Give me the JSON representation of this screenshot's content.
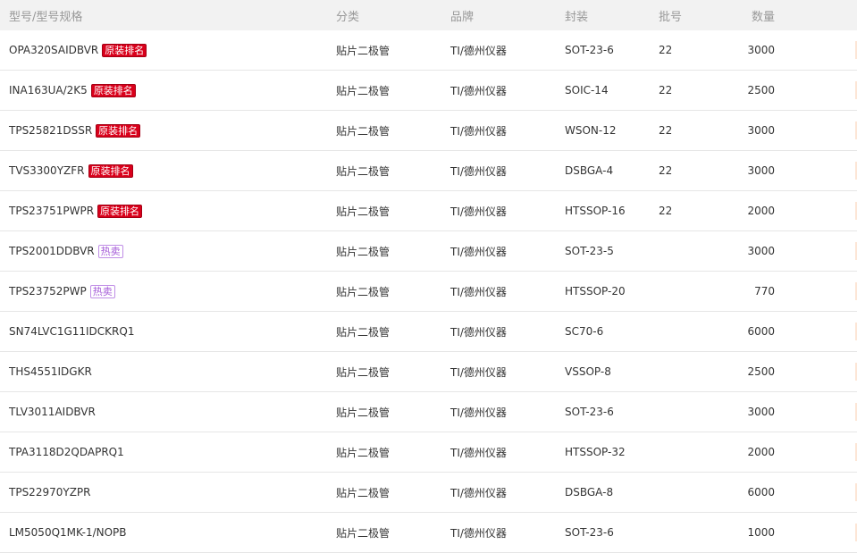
{
  "header": {
    "model": "型号/型号规格",
    "category": "分类",
    "brand": "品牌",
    "package": "封装",
    "batch": "批号",
    "quantity": "数量"
  },
  "rows": [
    {
      "model": "OPA320SAIDBVR",
      "badge": "原装排名",
      "badge_type": "red",
      "category": "贴片二极管",
      "brand": "TI/德州仪器",
      "package": "SOT-23-6",
      "batch": "22",
      "quantity": "3000"
    },
    {
      "model": "INA163UA/2K5",
      "badge": "原装排名",
      "badge_type": "red",
      "category": "贴片二极管",
      "brand": "TI/德州仪器",
      "package": "SOIC-14",
      "batch": "22",
      "quantity": "2500"
    },
    {
      "model": "TPS25821DSSR",
      "badge": "原装排名",
      "badge_type": "red",
      "category": "贴片二极管",
      "brand": "TI/德州仪器",
      "package": "WSON-12",
      "batch": "22",
      "quantity": "3000"
    },
    {
      "model": "TVS3300YZFR",
      "badge": "原装排名",
      "badge_type": "red",
      "category": "贴片二极管",
      "brand": "TI/德州仪器",
      "package": "DSBGA-4",
      "batch": "22",
      "quantity": "3000"
    },
    {
      "model": "TPS23751PWPR",
      "badge": "原装排名",
      "badge_type": "red",
      "category": "贴片二极管",
      "brand": "TI/德州仪器",
      "package": "HTSSOP-16",
      "batch": "22",
      "quantity": "2000"
    },
    {
      "model": "TPS2001DDBVR",
      "badge": "热卖",
      "badge_type": "purple",
      "category": "贴片二极管",
      "brand": "TI/德州仪器",
      "package": "SOT-23-5",
      "batch": "",
      "quantity": "3000"
    },
    {
      "model": "TPS23752PWP",
      "badge": "热卖",
      "badge_type": "purple",
      "category": "贴片二极管",
      "brand": "TI/德州仪器",
      "package": "HTSSOP-20",
      "batch": "",
      "quantity": "770"
    },
    {
      "model": "SN74LVC1G11IDCKRQ1",
      "badge": "",
      "badge_type": "",
      "category": "贴片二极管",
      "brand": "TI/德州仪器",
      "package": "SC70-6",
      "batch": "",
      "quantity": "6000"
    },
    {
      "model": "THS4551IDGKR",
      "badge": "",
      "badge_type": "",
      "category": "贴片二极管",
      "brand": "TI/德州仪器",
      "package": "VSSOP-8",
      "batch": "",
      "quantity": "2500"
    },
    {
      "model": "TLV3011AIDBVR",
      "badge": "",
      "badge_type": "",
      "category": "贴片二极管",
      "brand": "TI/德州仪器",
      "package": "SOT-23-6",
      "batch": "",
      "quantity": "3000"
    },
    {
      "model": "TPA3118D2QDAPRQ1",
      "badge": "",
      "badge_type": "",
      "category": "贴片二极管",
      "brand": "TI/德州仪器",
      "package": "HTSSOP-32",
      "batch": "",
      "quantity": "2000"
    },
    {
      "model": "TPS22970YZPR",
      "badge": "",
      "badge_type": "",
      "category": "贴片二极管",
      "brand": "TI/德州仪器",
      "package": "DSBGA-8",
      "batch": "",
      "quantity": "6000"
    },
    {
      "model": "LM5050Q1MK-1/NOPB",
      "badge": "",
      "badge_type": "",
      "category": "贴片二极管",
      "brand": "TI/德州仪器",
      "package": "SOT-23-6",
      "batch": "",
      "quantity": "1000"
    }
  ]
}
